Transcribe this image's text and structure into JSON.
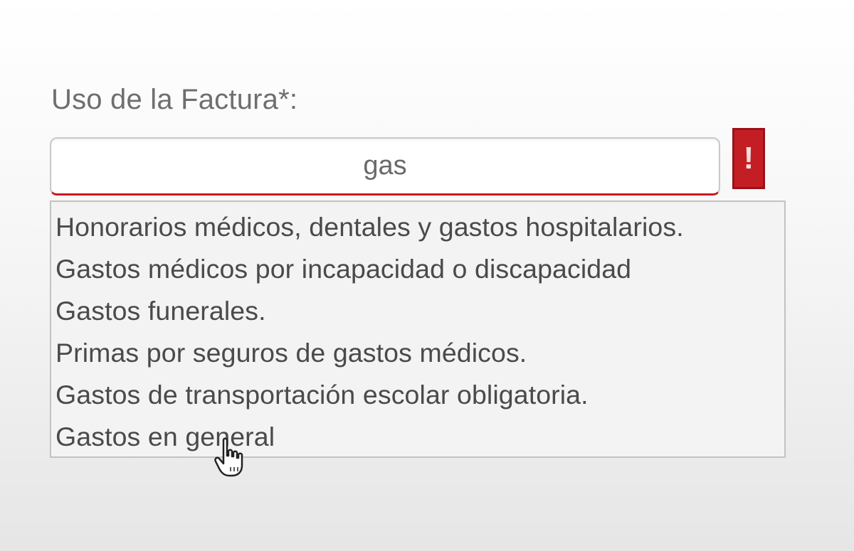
{
  "field": {
    "label": "Uso de la Factura*:",
    "value": "gas"
  },
  "error": {
    "mark": "!",
    "color": "#c41e25"
  },
  "dropdown": {
    "options": [
      "Honorarios médicos, dentales y gastos hospitalarios.",
      "Gastos médicos por incapacidad o discapacidad",
      "Gastos funerales.",
      "Primas por seguros de gastos médicos.",
      "Gastos de transportación escolar obligatoria.",
      "Gastos en general"
    ]
  },
  "cursor": {
    "icon": "hand-pointer-icon"
  }
}
